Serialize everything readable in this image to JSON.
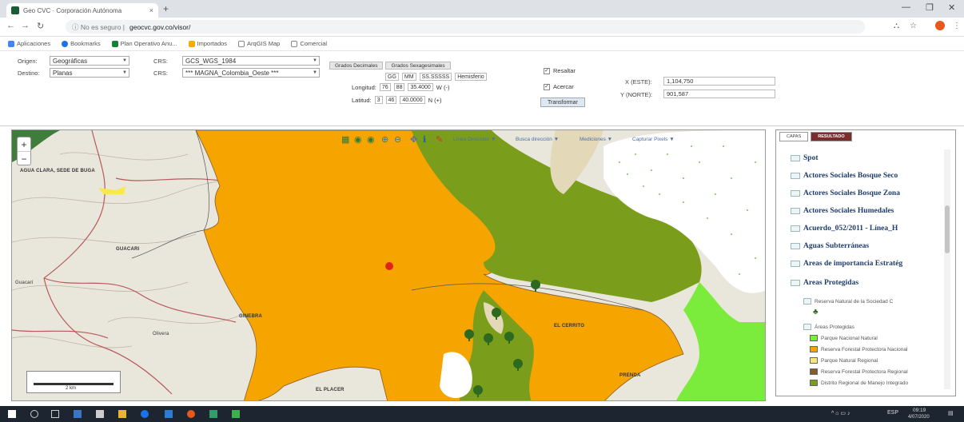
{
  "browser": {
    "tab_title": "Geo CVC · Corporación Autónoma",
    "tab_close": "×",
    "new_tab": "+",
    "address_info": "ⓘ No es seguro |",
    "address_url": "geocvc.gov.co/visor/",
    "bookmarks": [
      {
        "label": "Aplicaciones",
        "color": "#4285f4"
      },
      {
        "label": "Bookmarks",
        "color": "#1a73e8"
      },
      {
        "label": "Plan Operativo Anu...",
        "color": "#188038"
      },
      {
        "label": "Importados",
        "color": "#f9ab00"
      },
      {
        "label": "ArqGIS Map",
        "color": "#ffffff"
      },
      {
        "label": "Comercial",
        "color": "#ffffff"
      }
    ]
  },
  "converter": {
    "origen_label": "Origen:",
    "origen_value": "Geográficas",
    "destino_label": "Destino:",
    "destino_value": "Planas",
    "crs1_label": "CRS:",
    "crs1_value": "GCS_WGS_1984",
    "crs2_label": "CRS:",
    "crs2_value": "*** MAGNA_Colombia_Oeste ***",
    "format_buttons": [
      "Grados Decimales",
      "Grados Sexagesimales"
    ],
    "columns": [
      "GG",
      "MM",
      "SS.SSSSS",
      "Hemisferio"
    ],
    "longitud_label": "Longitud:",
    "longitud_values": [
      "76",
      "88",
      "35.4000",
      "W (-)"
    ],
    "latitud_label": "Latitud:",
    "latitud_values": [
      "3",
      "46",
      "40.0000",
      "N (+)"
    ],
    "resaltar_label": "Resaltar",
    "acercar_label": "Acercar",
    "check_mark": "✓",
    "transform_button": "Transformar",
    "x_label": "X (ESTE):",
    "x_value": "1,104,750",
    "y_label": "Y (NORTE):",
    "y_value": "901,587"
  },
  "map": {
    "menus": [
      "Línea Dirección ▼",
      "Busca dirección ▼",
      "Mediciones ▼",
      "Capturar Pixels ▼"
    ],
    "places": [
      "AGUA CLARA, SEDE DE BUGA",
      "GUACARI",
      "Guacarí",
      "GINEBRA",
      "Olivera",
      "EL CERRITO",
      "PRENDA",
      "EL PLACER"
    ],
    "scale_label": "2 km",
    "colors": {
      "background": "#e9e6dc",
      "protected_orange": "#f5a400",
      "forest_green": "#7a9e1c",
      "light_green": "#7cec3c",
      "marker": "#e2231a"
    }
  },
  "panel": {
    "tabs": [
      "CAPAS",
      "RESULTADO"
    ],
    "layers": [
      "Spot",
      "Actores Sociales Bosque Seco",
      "Actores Sociales Bosque Zona",
      "Actores Sociales Humedales",
      "Acuerdo_052/2011 - Línea_H",
      "Aguas Subterráneas",
      "Áreas de importancia Estratég",
      "Áreas Protegidas"
    ],
    "sub_items": [
      "Reserva Natural de la Sociedad C",
      "Áreas Protegidas"
    ],
    "legend": [
      {
        "label": "Parque Nacional Natural",
        "color": "#7cec3c"
      },
      {
        "label": "Reserva Forestal Protectora Nacional",
        "color": "#f5a400"
      },
      {
        "label": "Parque Natural Regional",
        "color": "#f7e67a"
      },
      {
        "label": "Reserva Forestal Protectora Regional",
        "color": "#8b5a2b"
      },
      {
        "label": "Distrito Regional de Manejo Integrado",
        "color": "#7a9e1c"
      }
    ]
  },
  "taskbar": {
    "time": "09:19",
    "date": "4/07/2020",
    "lang": "ESP"
  }
}
